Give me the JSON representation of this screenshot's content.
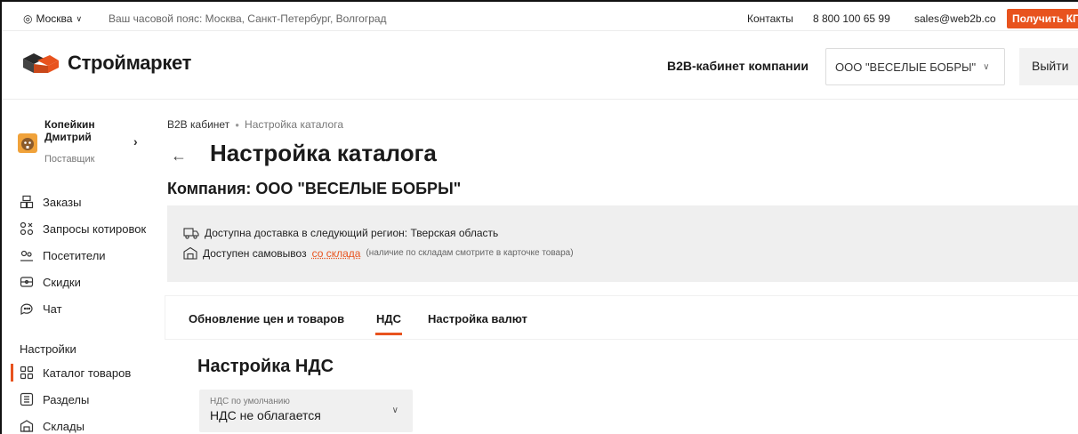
{
  "topbar": {
    "city": "Москва",
    "timezone": "Ваш часовой пояс: Москва, Санкт-Петербург, Волгоград",
    "contacts": "Контакты",
    "phone": "8 800 100 65 99",
    "email": "sales@web2b.co",
    "cta": "Получить КП"
  },
  "header": {
    "logo": "Строймаркет",
    "b2b_label": "B2B-кабинет компании",
    "company": "ООО \"ВЕСЕЛЫЕ БОБРЫ\"",
    "logout": "Выйти"
  },
  "user": {
    "name": "Копейкин Дмитрий",
    "role": "Поставщик"
  },
  "sidebar": {
    "items": [
      {
        "label": "Заказы",
        "icon": "orders-icon"
      },
      {
        "label": "Запросы котировок",
        "icon": "quotes-icon"
      },
      {
        "label": "Посетители",
        "icon": "visitors-icon"
      },
      {
        "label": "Скидки",
        "icon": "discounts-icon"
      },
      {
        "label": "Чат",
        "icon": "chat-icon"
      }
    ],
    "settings_title": "Настройки",
    "settings_items": [
      {
        "label": "Каталог товаров",
        "icon": "catalog-icon",
        "active": true
      },
      {
        "label": "Разделы",
        "icon": "sections-icon"
      },
      {
        "label": "Склады",
        "icon": "warehouses-icon"
      }
    ]
  },
  "main": {
    "breadcrumb": [
      "B2B кабинет",
      "Настройка каталога"
    ],
    "title": "Настройка каталога",
    "company_title": "Компания: ООО \"ВЕСЕЛЫЕ БОБРЫ\"",
    "delivery_text": "Доступна доставка в следующий регион: Тверская область",
    "pickup_text": "Доступен самовывоз",
    "pickup_link": "со склада",
    "pickup_note": "(наличие по складам смотрите в карточке товара)",
    "tabs": [
      {
        "label": "Обновление цен и товаров",
        "active": false
      },
      {
        "label": "НДС",
        "active": true
      },
      {
        "label": "Настройка валют",
        "active": false
      }
    ],
    "section_title": "Настройка НДС",
    "vat_select": {
      "label": "НДС по умолчанию",
      "value": "НДС не облагается"
    }
  },
  "colors": {
    "accent": "#e8531e",
    "gray_bg": "#efefef"
  }
}
